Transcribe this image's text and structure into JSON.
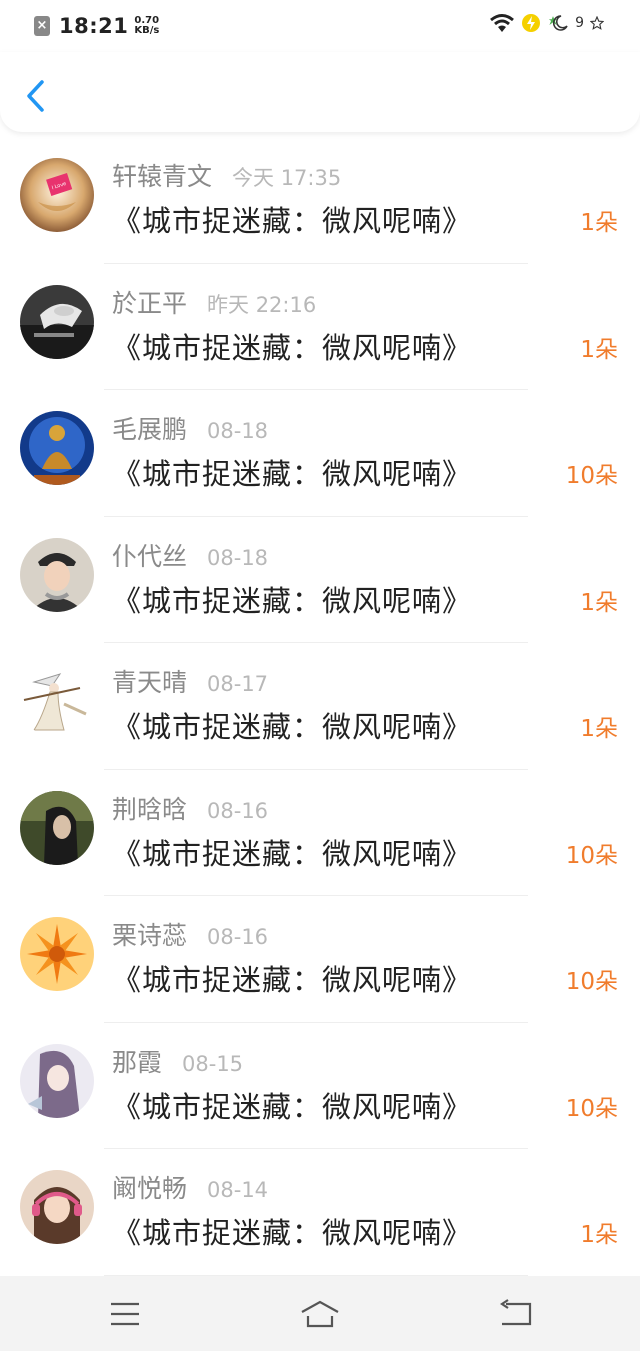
{
  "status_bar": {
    "time": "18:21",
    "speed_value": "0.70",
    "speed_unit": "KB/s",
    "battery_badge": "9",
    "icons": [
      "sim-icon",
      "wifi-icon",
      "charging-icon",
      "moon-star-icon"
    ]
  },
  "header": {
    "back_icon": "chevron-left-icon"
  },
  "colors": {
    "accent": "#2196f3",
    "flower_count": "#f07c2c",
    "name": "#8a8a8a",
    "time": "#b8b8b8"
  },
  "list": [
    {
      "name": "轩辕青文",
      "time": "今天 17:35",
      "title": "《城市捉迷藏：微风呢喃》",
      "count": "1朵",
      "avatar": "heart-note"
    },
    {
      "name": "於正平",
      "time": "昨天 22:16",
      "title": "《城市捉迷藏：微风呢喃》",
      "count": "1朵",
      "avatar": "bw-hand"
    },
    {
      "name": "毛展鹏",
      "time": "08-18",
      "title": "《城市捉迷藏：微风呢喃》",
      "count": "10朵",
      "avatar": "buddha"
    },
    {
      "name": "仆代丝",
      "time": "08-18",
      "title": "《城市捉迷藏：微风呢喃》",
      "count": "1朵",
      "avatar": "man-cap"
    },
    {
      "name": "青天晴",
      "time": "08-17",
      "title": "《城市捉迷藏：微风呢喃》",
      "count": "1朵",
      "avatar": "swordsman"
    },
    {
      "name": "荆晗晗",
      "time": "08-16",
      "title": "《城市捉迷藏：微风呢喃》",
      "count": "10朵",
      "avatar": "girl-dark"
    },
    {
      "name": "栗诗蕊",
      "time": "08-16",
      "title": "《城市捉迷藏：微风呢喃》",
      "count": "10朵",
      "avatar": "orange-flower"
    },
    {
      "name": "那霞",
      "time": "08-15",
      "title": "《城市捉迷藏：微风呢喃》",
      "count": "10朵",
      "avatar": "anime-girl"
    },
    {
      "name": "阚悦畅",
      "time": "08-14",
      "title": "《城市捉迷藏：微风呢喃》",
      "count": "1朵",
      "avatar": "headphone-girl"
    }
  ],
  "nav_bar": {
    "icons": [
      "menu-icon",
      "home-icon",
      "back-icon"
    ]
  }
}
